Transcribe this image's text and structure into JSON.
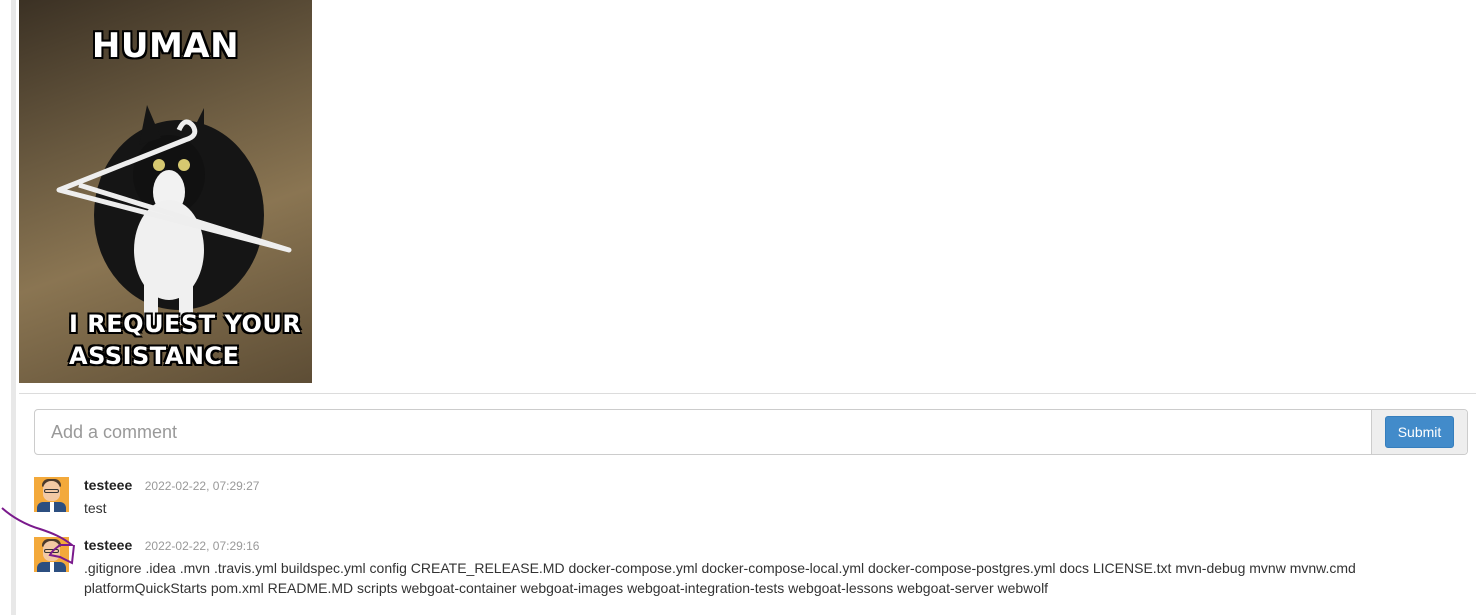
{
  "meme": {
    "top_text": "HUMAN",
    "bottom_text": "I REQUEST YOUR ASSISTANCE"
  },
  "comment_form": {
    "placeholder": "Add a comment",
    "submit_label": "Submit"
  },
  "comments": [
    {
      "author": "testeee",
      "timestamp": "2022-02-22, 07:29:27",
      "text": "test"
    },
    {
      "author": "testeee",
      "timestamp": "2022-02-22, 07:29:16",
      "text": ".gitignore .idea .mvn .travis.yml buildspec.yml config CREATE_RELEASE.MD docker-compose.yml docker-compose-local.yml docker-compose-postgres.yml docs LICENSE.txt mvn-debug mvnw mvnw.cmd platformQuickStarts pom.xml README.MD scripts webgoat-container webgoat-images webgoat-integration-tests webgoat-lessons webgoat-server webwolf"
    }
  ],
  "colors": {
    "submit_button": "#428bca",
    "annotation_scribble": "#7a1a8c"
  }
}
